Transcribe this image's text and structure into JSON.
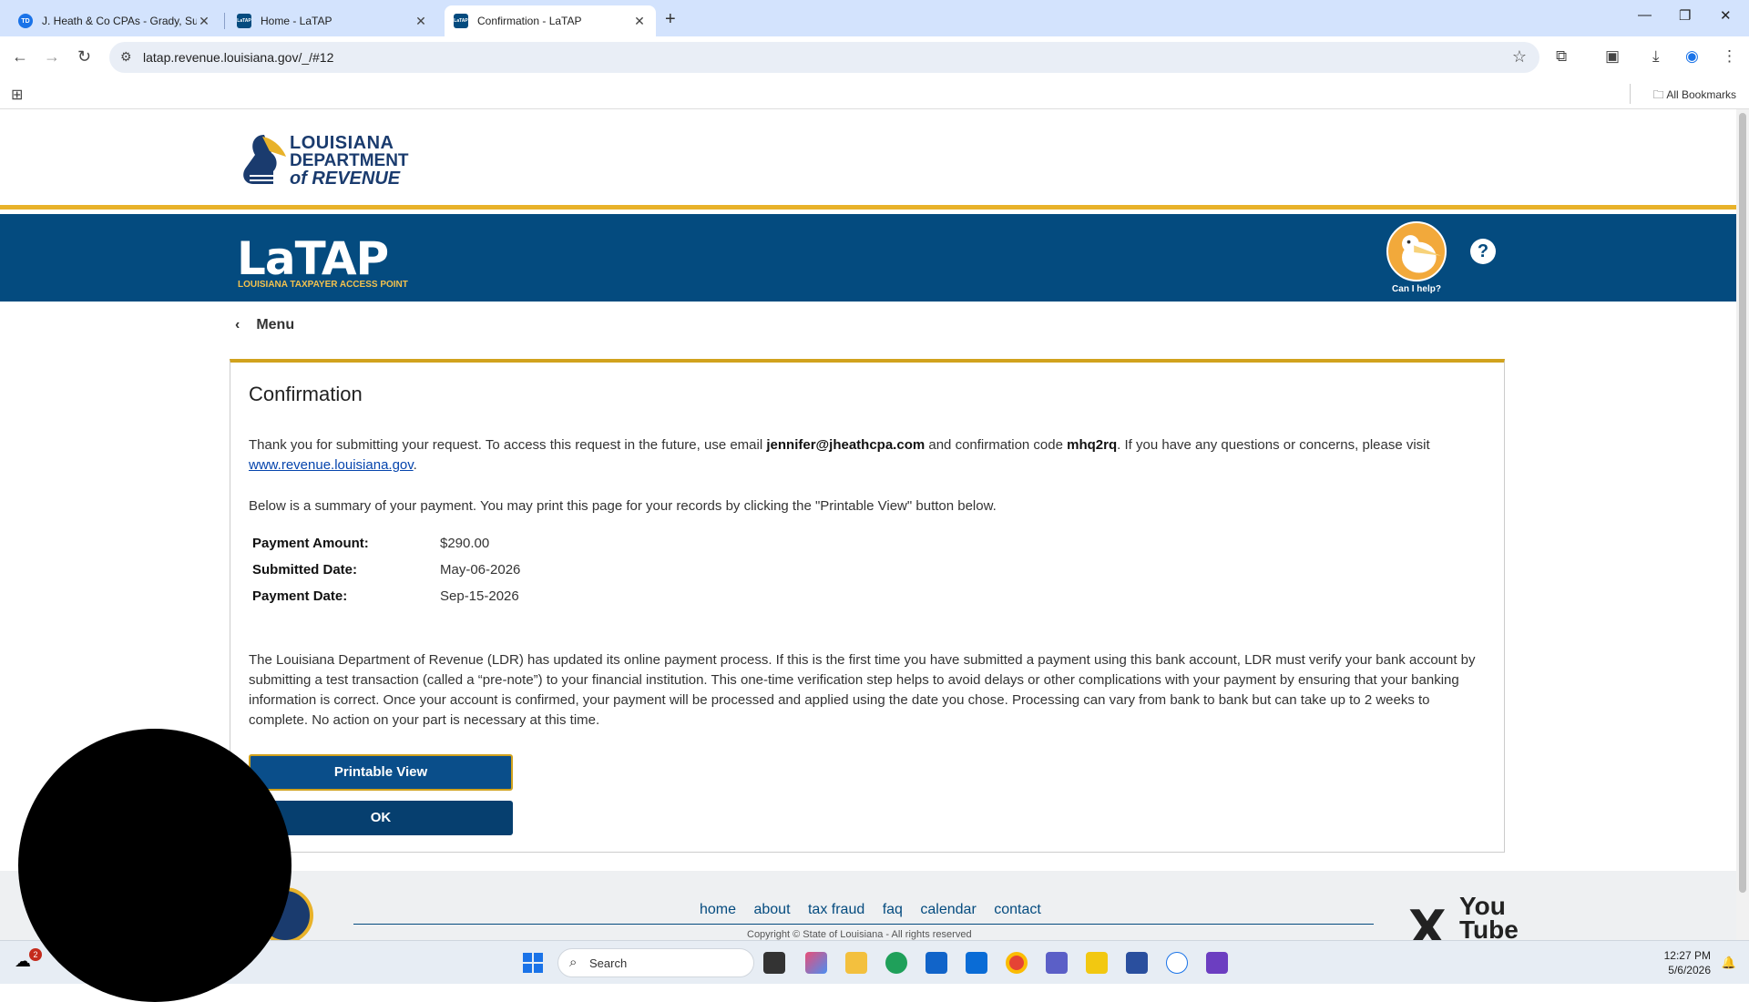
{
  "browser": {
    "tabs": [
      {
        "title": "J. Heath & Co CPAs - Grady, Su",
        "favicon": "TD"
      },
      {
        "title": "Home - LaTAP",
        "favicon": "LaTAP"
      },
      {
        "title": "Confirmation - LaTAP",
        "favicon": "LaTAP",
        "active": true
      }
    ],
    "url": "latap.revenue.louisiana.gov/_/#12",
    "all_bookmarks": "All Bookmarks"
  },
  "header": {
    "logo_line1": "LOUISIANA",
    "logo_line2": "DEPARTMENT",
    "logo_line3": "of REVENUE",
    "latap": "LaTAP",
    "latap_sub": "LOUISIANA TAXPAYER ACCESS POINT",
    "can_help": "Can I help?",
    "help_symbol": "?"
  },
  "menu_label": "Menu",
  "confirmation": {
    "title": "Confirmation",
    "intro_1": "Thank you for submitting your request. To access this request in the future, use email ",
    "email": "jennifer@jheathcpa.com",
    "intro_2": " and confirmation code ",
    "code": "mhq2rq",
    "intro_3": ". If you have any questions or concerns, please visit ",
    "link": "www.revenue.louisiana.gov",
    "intro_4": ".",
    "summary_text": "Below is a summary of your payment. You may print this page for your records by clicking the \"Printable View\" button below.",
    "summary": [
      {
        "label": "Payment Amount:",
        "value": "$290.00"
      },
      {
        "label": "Submitted Date:",
        "value": "May-06-2026"
      },
      {
        "label": "Payment Date:",
        "value": "Sep-15-2026"
      }
    ],
    "notice": "The Louisiana Department of Revenue (LDR) has updated its online payment process. If this is the first time you have submitted a payment using this bank account, LDR must verify your bank account by submitting a test transaction (called a “pre-note”) to your financial institution. This one-time verification step helps to avoid delays or other complications with your payment by ensuring that your banking information is correct. Once your account is confirmed, your payment will be processed and applied using the date you chose. Processing can vary from bank to bank but can take up to 2 weeks to complete. No action on your part is necessary at this time.",
    "printable_button": "Printable View",
    "ok_button": "OK"
  },
  "footer": {
    "links": [
      "home",
      "about",
      "tax fraud",
      "faq",
      "calendar",
      "contact"
    ],
    "copyright": "Copyright © State of Louisiana - All rights reserved",
    "social_x": "X",
    "social_yt": "You Tube"
  },
  "taskbar": {
    "search_placeholder": "Search",
    "badge": "2",
    "time": "12:27 PM",
    "date": "5/6/2026"
  },
  "colors": {
    "brand_blue": "#044b7f",
    "gold": "#e8b22a",
    "button_blue": "#0a4e8a"
  }
}
